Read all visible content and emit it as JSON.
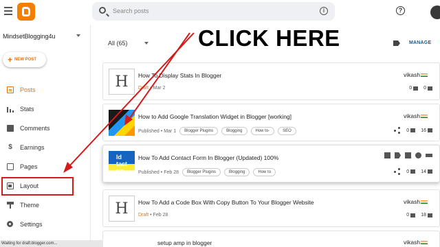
{
  "topbar": {
    "search_placeholder": "Search posts",
    "icons": [
      "menu-icon",
      "blogger-logo",
      "search-icon",
      "info-icon",
      "help-icon",
      "avatar"
    ]
  },
  "sidebar": {
    "blog_name": "MindsetBlogging4u",
    "new_post_label": "+ NEW POST",
    "items": [
      {
        "label": "Posts",
        "icon": "posts-icon",
        "active": true
      },
      {
        "label": "Stats",
        "icon": "stats-icon"
      },
      {
        "label": "Comments",
        "icon": "comments-icon"
      },
      {
        "label": "Earnings",
        "icon": "dollar-icon"
      },
      {
        "label": "Pages",
        "icon": "pages-icon"
      },
      {
        "label": "Layout",
        "icon": "layout-icon",
        "highlighted": true
      },
      {
        "label": "Theme",
        "icon": "theme-icon"
      },
      {
        "label": "Settings",
        "icon": "settings-icon"
      }
    ]
  },
  "main": {
    "filter_label": "All (65)",
    "manage_label": "MANAGE",
    "posts": [
      {
        "title": "How To Display Stats In Blogger",
        "status": "Draft",
        "date": "Mar 2",
        "labels": [],
        "author": "vikash",
        "comments": "0",
        "views": "0"
      },
      {
        "title": "How to Add Google Translation Widget in Blogger [working]",
        "status": "Published",
        "date": "Mar 1",
        "labels": [
          "Blogger Plugins",
          "Blogging",
          "How to-",
          "SEO"
        ],
        "author": "vikash",
        "comments": "0",
        "views": "16"
      },
      {
        "title": "How To Add Contact Form In Blogger (Updated) 100%",
        "status": "Published",
        "date": "Feb 28",
        "labels": [
          "Blogger Plugins",
          "Blogging",
          "How to"
        ],
        "author": "",
        "comments": "0",
        "views": "14",
        "thumb_text": "ld\ntact\nrm"
      },
      {
        "title": "How To Add a Code Box With Copy Button To Your Blogger Website",
        "status": "Draft",
        "date": "Feb 28",
        "labels": [],
        "author": "vikash",
        "comments": "0",
        "views": "18"
      },
      {
        "title": "setup amp in blogger",
        "author": "vikash"
      }
    ]
  },
  "overlay": {
    "callout": "CLICK HERE",
    "accent": "#d41a1a"
  },
  "status_bar": "Waiting for draft.blogger.com...",
  "colors": {
    "accent_orange": "#e8710a",
    "link_blue": "#1a5c8a",
    "search_bg": "#eef0f3"
  }
}
